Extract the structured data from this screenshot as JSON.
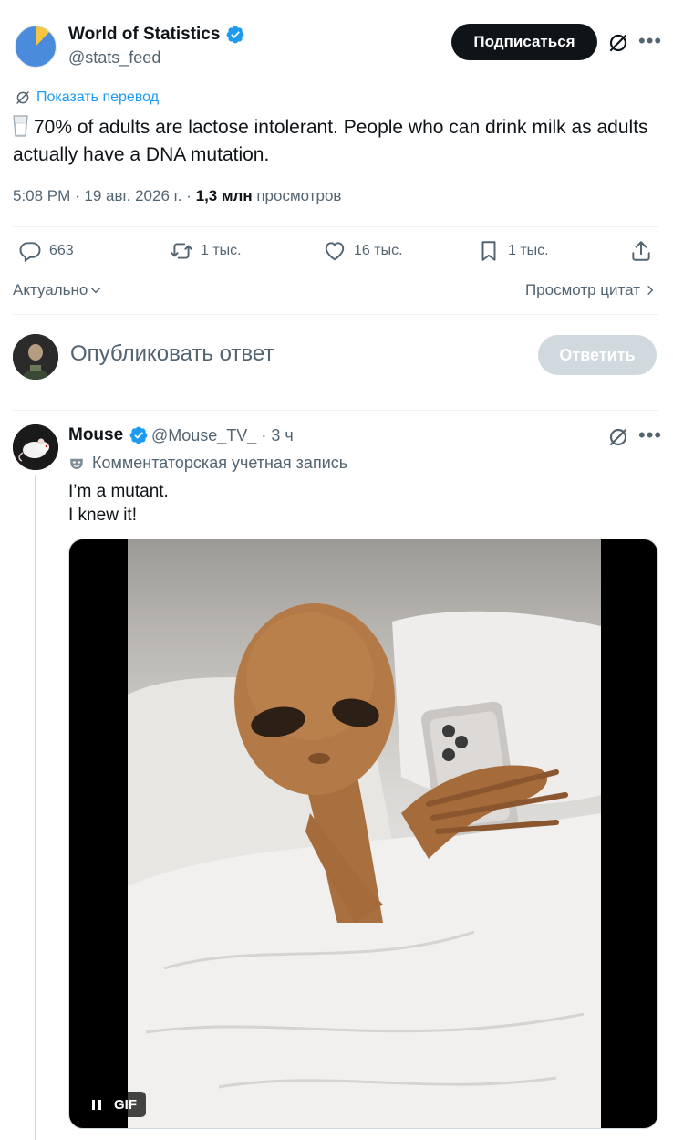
{
  "tweet": {
    "author_name": "World of Statistics",
    "author_handle": "@stats_feed",
    "follow_label": "Подписаться",
    "translate_label": "Показать перевод",
    "text": "70% of adults are lactose intolerant. People who can drink milk as adults actually have a DNA mutation.",
    "time": "5:08 PM · 19 авг. 2026 г. · ",
    "views_count": "1,3 млн",
    "views_label": " просмотров"
  },
  "actions": {
    "replies": "663",
    "reposts": "1 тыс.",
    "likes": "16 тыс.",
    "bookmarks": "1 тыс."
  },
  "sort": {
    "relevance_label": "Актуально",
    "quotes_label": "Просмотр цитат"
  },
  "composer": {
    "placeholder": "Опубликовать ответ",
    "reply_label": "Ответить"
  },
  "reply": {
    "author_name": "Mouse",
    "author_handle": "@Mouse_TV_ · 3 ч",
    "account_label": "Комментаторская учетная запись",
    "line1": "I’m a mutant.",
    "line2": "I knew it!",
    "gif_label": "GIF"
  },
  "colors": {
    "accent": "#1d9bf0",
    "text": "#0f1419",
    "muted": "#536471",
    "follow_bg": "#0f1419",
    "reply_btn_disabled": "#cfd9de"
  },
  "icons": {
    "verified": "verified-badge-icon",
    "grok": "grok-icon",
    "more": "more-icon",
    "reply": "reply-icon",
    "repost": "repost-icon",
    "like": "heart-icon",
    "bookmark": "bookmark-icon",
    "share": "share-icon"
  }
}
